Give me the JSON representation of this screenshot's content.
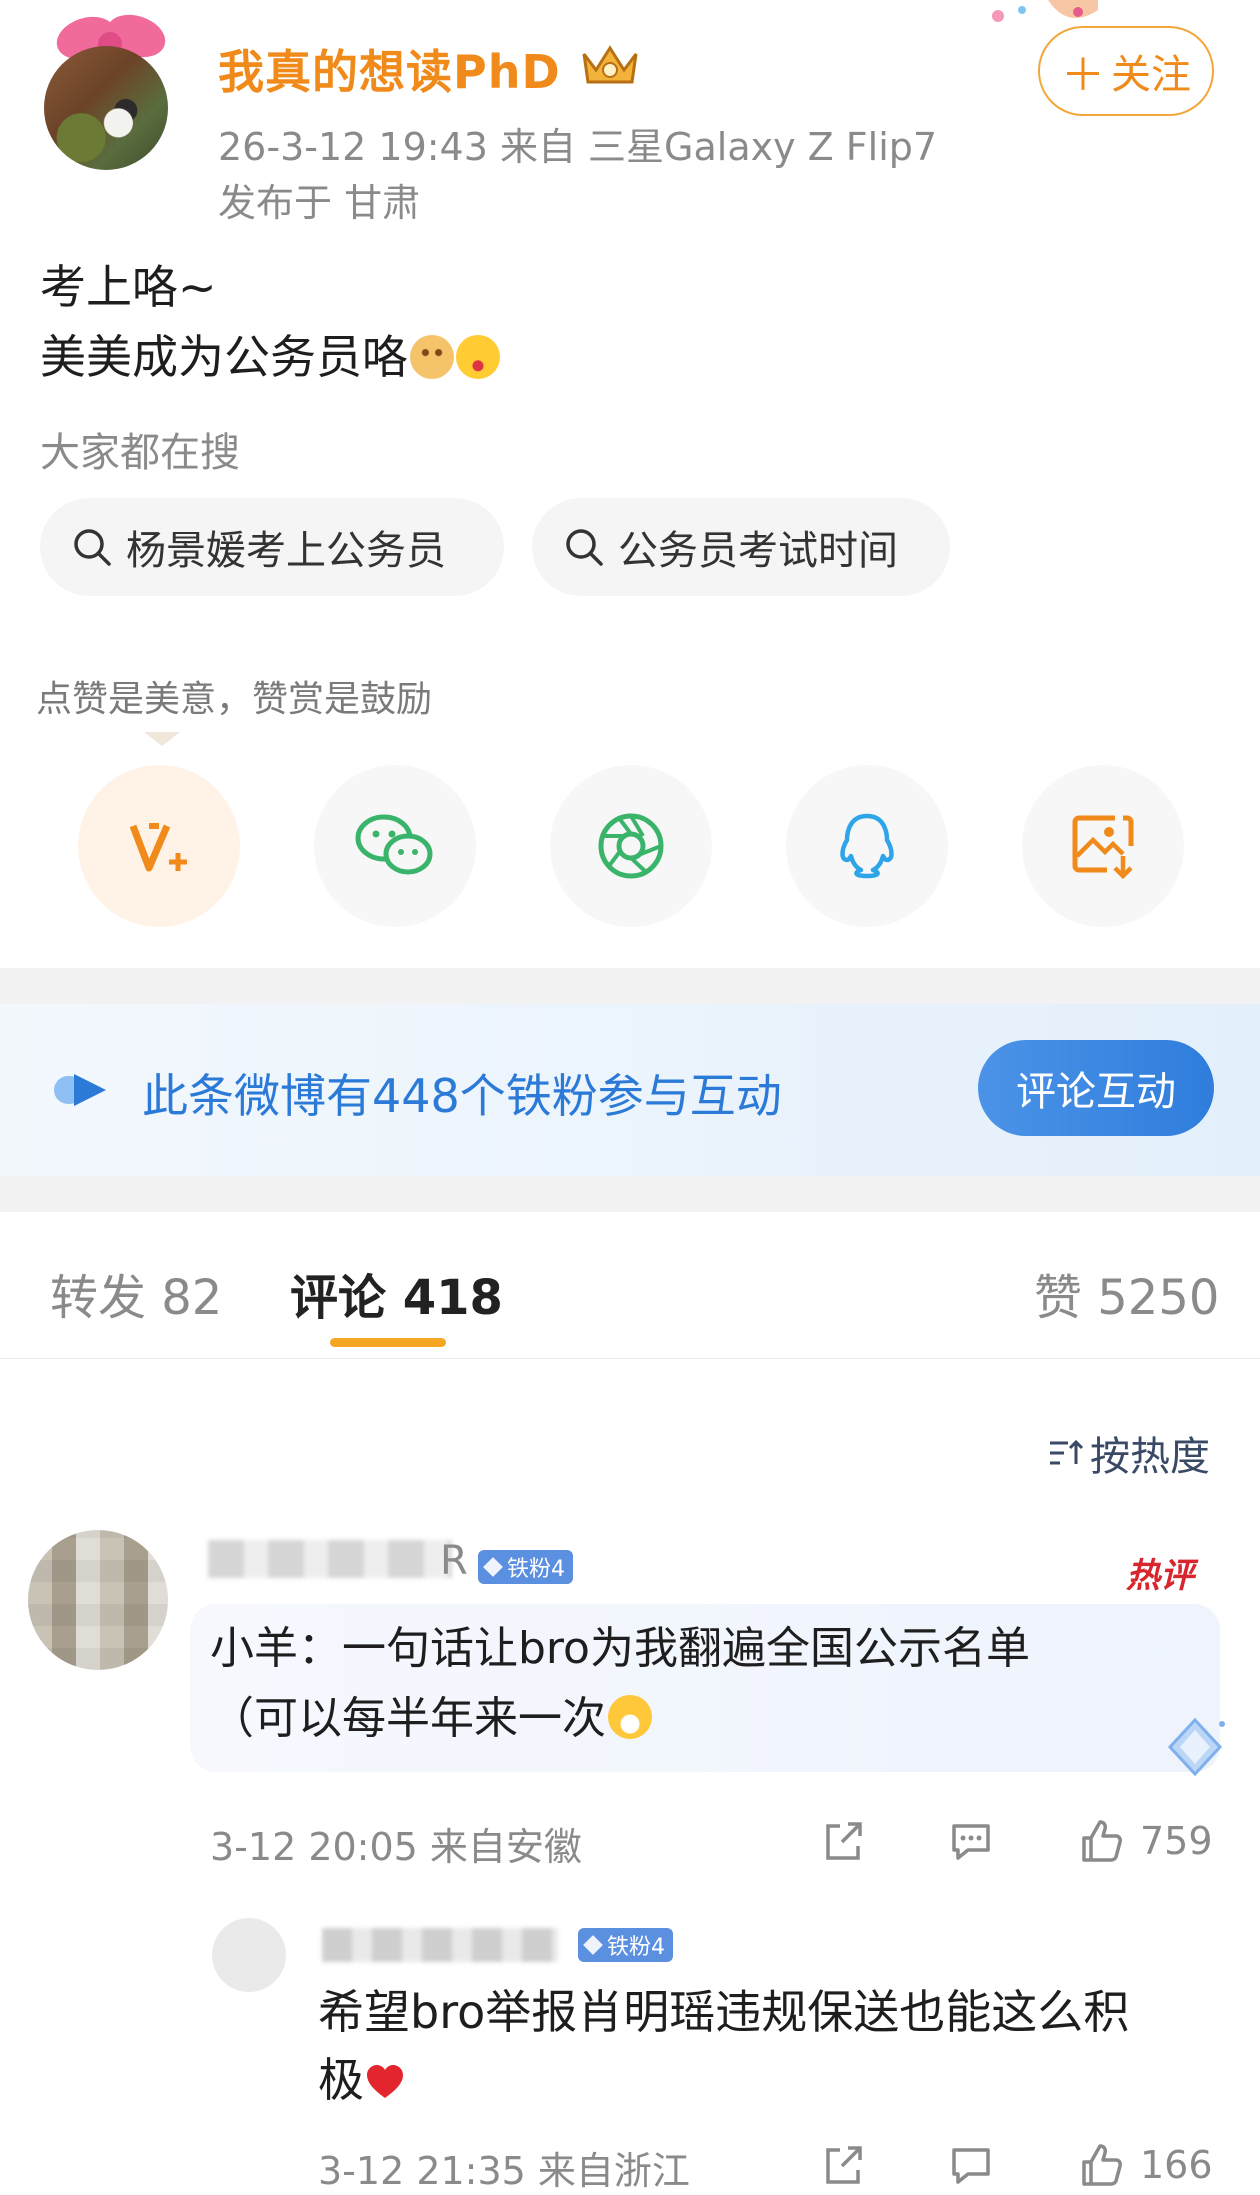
{
  "post": {
    "username": "我真的想读PhD",
    "follow_label": "关注",
    "follow_plus": "＋",
    "meta_line1": "26-3-12 19:43   来自 三星Galaxy Z Flip7",
    "meta_line2": "发布于 甘肃",
    "content_line1": "考上咯~",
    "content_line2": "美美成为公务员咯"
  },
  "search": {
    "title": "大家都在搜",
    "chips": [
      "杨景媛考上公务员",
      "公务员考试时间"
    ]
  },
  "reward": {
    "tip": "点赞是美意，赞赏是鼓励",
    "share_icons": [
      "v-plus-icon",
      "wechat-icon",
      "moments-icon",
      "qq-icon",
      "save-image-icon"
    ]
  },
  "fans": {
    "text": "此条微博有448个铁粉参与互动",
    "button": "评论互动"
  },
  "tabs": {
    "repost": "转发 82",
    "comment": "评论 418",
    "like": "赞 5250"
  },
  "sort_label": "按热度",
  "comments": [
    {
      "name_tail": "R",
      "badge": "铁粉4",
      "hot_label": "热评",
      "text_line1": "小羊：一句话让bro为我翻遍全国公示名单",
      "text_line2": "（可以每半年来一次",
      "meta": "3-12 20:05  来自安徽",
      "likes": "759"
    }
  ],
  "reply": {
    "badge": "铁粉4",
    "text_line1": "希望bro举报肖明瑶违规保送也能这么积",
    "text_line2": "极",
    "meta": "3-12 21:35  来自浙江",
    "likes": "166"
  },
  "colors": {
    "brand_orange": "#f08a1a",
    "link_blue": "#2c7ad8",
    "tab_underline": "#f5a623",
    "hot_red": "#d8262e"
  }
}
